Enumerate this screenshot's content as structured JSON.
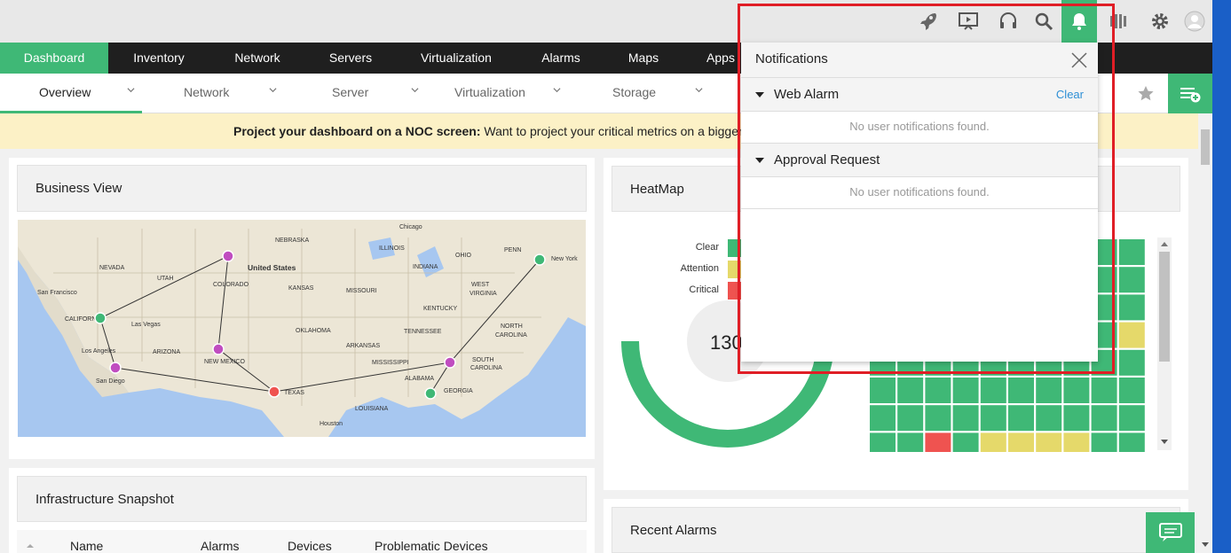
{
  "toolbar": {
    "icons": [
      "rocket-icon",
      "presentation-icon",
      "headset-icon",
      "search-icon",
      "bell-icon",
      "signal-icon",
      "gear-icon",
      "user-avatar-icon"
    ]
  },
  "main_nav": [
    {
      "label": "Dashboard",
      "active": true
    },
    {
      "label": "Inventory"
    },
    {
      "label": "Network"
    },
    {
      "label": "Servers"
    },
    {
      "label": "Virtualization"
    },
    {
      "label": "Alarms"
    },
    {
      "label": "Maps"
    },
    {
      "label": "Apps"
    }
  ],
  "sub_nav": [
    {
      "label": "Overview",
      "active": true
    },
    {
      "label": "Network"
    },
    {
      "label": "Server"
    },
    {
      "label": "Virtualization"
    },
    {
      "label": "Storage"
    }
  ],
  "banner": {
    "bold": "Project your dashboard on a NOC screen:",
    "text": " Want to project your critical metrics on a bigger scre"
  },
  "widgets": {
    "business_view": {
      "title": "Business View"
    },
    "heatmap": {
      "title": "HeatMap",
      "legend": [
        "Clear",
        "Attention",
        "Critical"
      ],
      "center_value": "130"
    },
    "infra": {
      "title": "Infrastructure Snapshot",
      "columns": [
        "Name",
        "Alarms",
        "Devices",
        "Problematic Devices"
      ]
    },
    "recent_alarms": {
      "title": "Recent Alarms"
    }
  },
  "map_labels": {
    "united_states": "United States",
    "nevada": "NEVADA",
    "utah": "UTAH",
    "colorado": "COLORADO",
    "nebraska": "NEBRASKA",
    "kansas": "KANSAS",
    "illinois": "ILLINOIS",
    "indiana": "INDIANA",
    "ohio": "OHIO",
    "penn": "PENN",
    "missouri": "MISSOURI",
    "kentucky": "KENTUCKY",
    "west_va": "WEST",
    "virginia": "VIRGINIA",
    "oklahoma": "OKLAHOMA",
    "arkansas": "ARKANSAS",
    "tennessee": "TENNESSEE",
    "north_carolina": "NORTH",
    "carolina": "CAROLINA",
    "south_carolina": "SOUTH",
    "south_carolina2": "CAROLINA",
    "mississippi": "MISSISSIPPI",
    "alabama": "ALABAMA",
    "georgia": "GEORGIA",
    "louisiana": "LOUISIANA",
    "texas": "TEXAS",
    "new_mexico": "NEW MEXICO",
    "arizona": "ARIZONA",
    "california": "CALIFORNIA",
    "chicago": "Chicago",
    "new_york": "New York",
    "san_francisco": "San Francisco",
    "las_vegas": "Las Vegas",
    "los_angeles": "Los Angeles",
    "san_diego": "San Diego",
    "houston": "Houston"
  },
  "notifications": {
    "title": "Notifications",
    "sections": [
      {
        "label": "Web Alarm",
        "action": "Clear",
        "empty": "No user notifications found."
      },
      {
        "label": "Approval Request",
        "empty": "No user notifications found."
      }
    ]
  },
  "colors": {
    "accent": "#3fb876",
    "attention": "#e5d96a",
    "critical": "#ef5350",
    "highlight": "#e01e26"
  }
}
